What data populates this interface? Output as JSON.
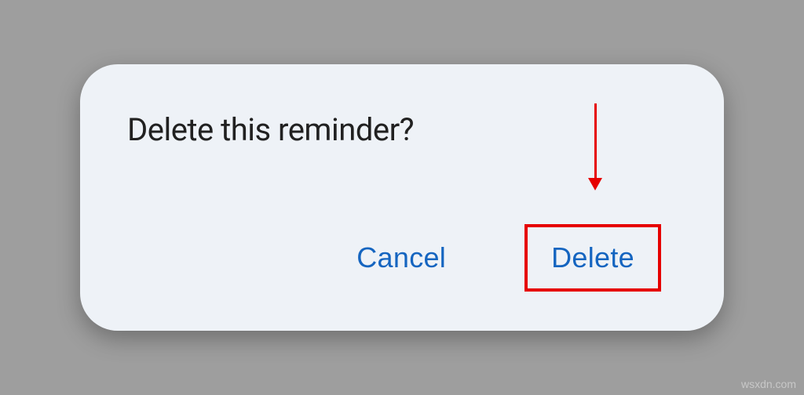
{
  "dialog": {
    "title": "Delete this reminder?",
    "cancel_label": "Cancel",
    "delete_label": "Delete"
  },
  "watermark": "wsxdn.com",
  "annotations": {
    "highlight_color": "#e60000",
    "arrow_target": "delete-button"
  }
}
